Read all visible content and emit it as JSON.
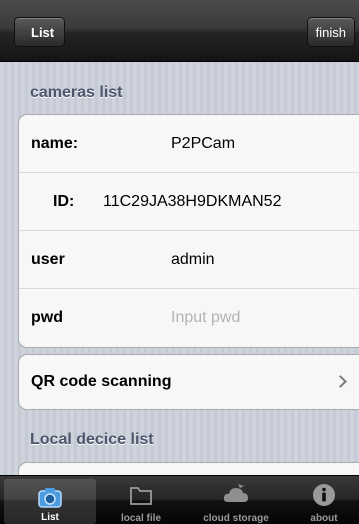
{
  "navbar": {
    "back_label": "List",
    "finish_label": "finish"
  },
  "cameras_section": {
    "title": "cameras list",
    "rows": [
      {
        "label": "name:",
        "value": "P2PCam"
      },
      {
        "label": "ID:",
        "value": "11C29JA38H9DKMAN52"
      },
      {
        "label": "user",
        "value": "admin"
      },
      {
        "label": "pwd",
        "placeholder": "Input pwd"
      }
    ]
  },
  "qr": {
    "label": "QR code scanning"
  },
  "local_section": {
    "title": "Local decice list"
  },
  "tabbar": {
    "tabs": [
      {
        "label": "List",
        "icon": "camera-icon",
        "active": true
      },
      {
        "label": "local file",
        "icon": "folder-icon"
      },
      {
        "label": "cloud storage",
        "icon": "cloud-icon"
      },
      {
        "label": "about",
        "icon": "info-icon"
      }
    ],
    "active_color": "#4a9be0"
  }
}
